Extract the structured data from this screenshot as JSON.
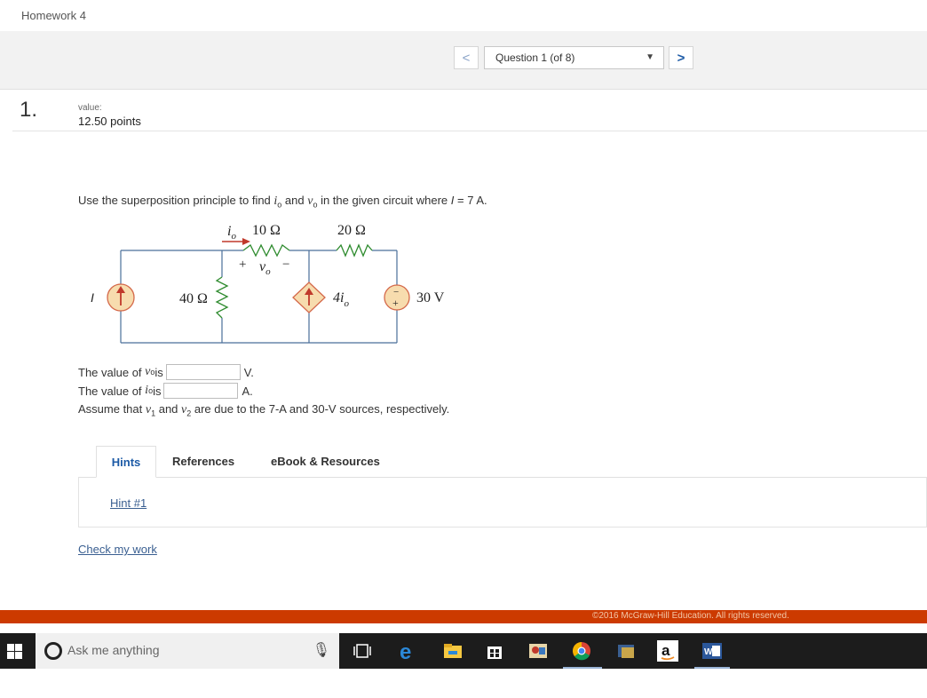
{
  "header": {
    "title": "Homework 4"
  },
  "nav": {
    "prev_label": "<",
    "next_label": ">",
    "question_select": "Question 1 (of 8)"
  },
  "question": {
    "number": "1.",
    "value_label": "value:",
    "value_points": "12.50 points",
    "prompt": {
      "p1": "Use the superposition principle to find ",
      "io": "i",
      "io_sub": "o",
      "p2": " and ",
      "vo": "v",
      "vo_sub": "o",
      "p3": " in the given circuit where ",
      "I": "I",
      "p4": " = 7 A."
    }
  },
  "circuit": {
    "io_label": "i",
    "io_sub": "o",
    "r1": "10 Ω",
    "r2": "20 Ω",
    "r3": "40 Ω",
    "vo_plus": "+",
    "vo_minus": "−",
    "vo_label": "v",
    "vo_sub": "o",
    "I_label": "I",
    "dep_source": "4i",
    "dep_sub": "o",
    "vs_label": "30 V",
    "vs_minus": "−",
    "vs_plus": "+"
  },
  "answers": {
    "vo": {
      "prefix": "The value of ",
      "var": "v",
      "sub": "o",
      "is": " is",
      "value": "",
      "unit": "V."
    },
    "io": {
      "prefix": "The value of ",
      "var": "i",
      "sub": "o",
      "is": " is",
      "value": "",
      "unit": "A."
    },
    "assume": {
      "p1": "Assume that ",
      "v1": "v",
      "v1_sub": "1",
      "p2": " and ",
      "v2": "v",
      "v2_sub": "2",
      "p3": " are due to the 7-A and 30-V sources, respectively."
    }
  },
  "tabs": {
    "hints": "Hints",
    "references": "References",
    "ebook": "eBook & Resources"
  },
  "hint_link": "Hint #1",
  "check_link": "Check my work",
  "footer": {
    "copyright": "©2016 McGraw-Hill Education. All rights reserved."
  },
  "taskbar": {
    "search_placeholder": "Ask me anything",
    "icons": [
      "windows-icon",
      "microphone-icon",
      "task-view-icon",
      "edge-icon",
      "file-explorer-icon",
      "store-icon",
      "photo-icon",
      "chrome-icon",
      "app-icon",
      "amazon-icon",
      "word-icon"
    ]
  },
  "colors": {
    "link": "#3a5f91",
    "accent": "#1c5aa6",
    "footer": "#cc3a00",
    "source_fill": "#f7dcae",
    "source_stroke": "#d4694a",
    "wire": "#4a6f9a",
    "resistor": "#2e8b2e",
    "arrow": "#c0392b"
  }
}
